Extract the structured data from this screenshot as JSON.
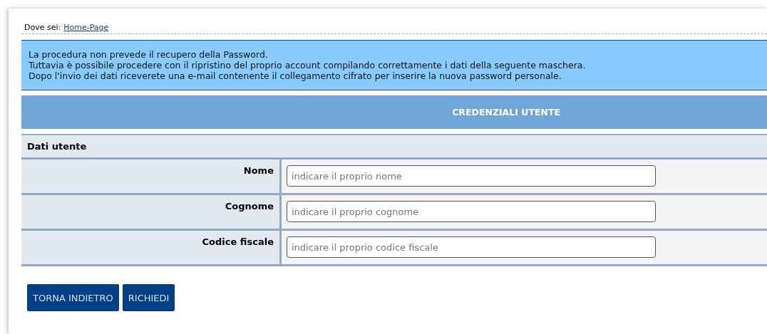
{
  "breadcrumb": {
    "label": "Dove sei:",
    "link": "Home-Page"
  },
  "notice": [
    "La procedura non prevede il recupero della Password.",
    "Tuttavia è possibile procedere con il ripristino del proprio account compilando correttamente i dati della seguente maschera.",
    "Dopo l'invio dei dati riceverete una e-mail contenente il collegamento cifrato per inserire la nuova password personale."
  ],
  "header": "CREDENZIALI UTENTE",
  "section": "Dati utente",
  "fields": [
    {
      "label": "Nome",
      "placeholder": "indicare il proprio nome"
    },
    {
      "label": "Cognome",
      "placeholder": "indicare il proprio cognome"
    },
    {
      "label": "Codice fiscale",
      "placeholder": "indicare il proprio codice fiscale"
    }
  ],
  "buttons": [
    "TORNA INDIETRO",
    "RICHIEDI"
  ]
}
